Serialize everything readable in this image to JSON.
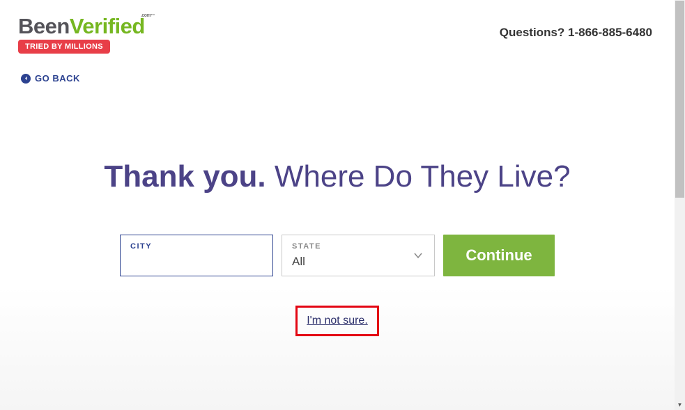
{
  "header": {
    "logo": {
      "part1": "Been",
      "part2": "Verified",
      "suffix_line1": ".com",
      "tm": "™"
    },
    "badge": "TRIED BY MILLIONS",
    "questions": "Questions? 1-866-885-6480"
  },
  "nav": {
    "go_back": "GO BACK"
  },
  "heading": {
    "bold": "Thank you.",
    "rest": " Where Do They Live?"
  },
  "form": {
    "city": {
      "label": "CITY",
      "value": ""
    },
    "state": {
      "label": "STATE",
      "value": "All"
    },
    "continue": "Continue"
  },
  "links": {
    "not_sure": "I'm not sure."
  }
}
